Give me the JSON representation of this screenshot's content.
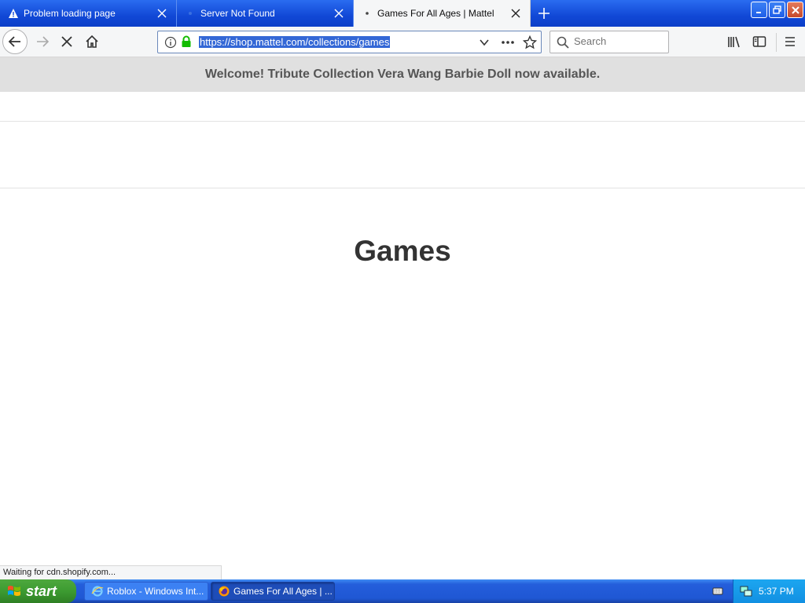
{
  "tabs": [
    {
      "label": "Problem loading page",
      "icon": "warning-icon",
      "active": false
    },
    {
      "label": "Server Not Found",
      "icon": "blank-page-icon",
      "active": false
    },
    {
      "label": "Games For All Ages | Mattel",
      "icon": "loading-icon",
      "active": true
    }
  ],
  "toolbar": {
    "url": "https://shop.mattel.com/collections/games",
    "search_placeholder": "Search"
  },
  "page": {
    "announcement": "Welcome! Tribute Collection Vera Wang Barbie Doll now available.",
    "heading": "Games"
  },
  "status_bar": {
    "text": "Waiting for cdn.shopify.com..."
  },
  "taskbar": {
    "start_label": "start",
    "items": [
      {
        "label": "Roblox - Windows Int...",
        "icon": "internet-explorer-icon"
      },
      {
        "label": "Games For All Ages | ...",
        "icon": "firefox-icon"
      }
    ],
    "clock": "5:37 PM"
  },
  "colors": {
    "titlebar_blue": "#1148d6",
    "url_selection": "#3367d6",
    "announcement_bg": "#e0e0e0",
    "start_green": "#3c9b31"
  }
}
